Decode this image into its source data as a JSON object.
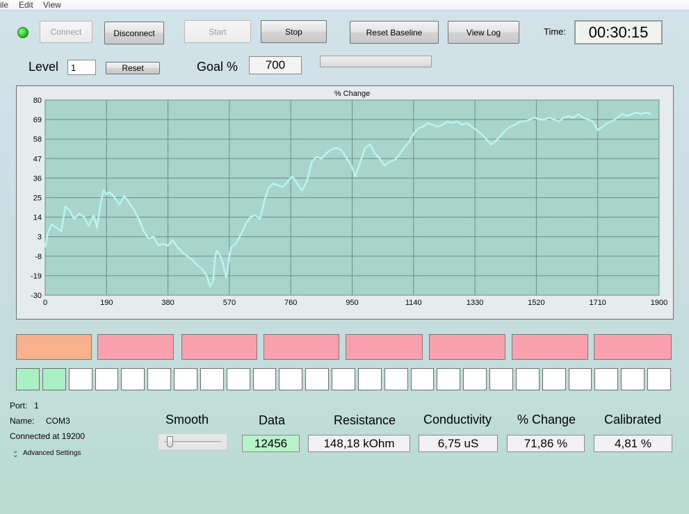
{
  "menu": {
    "file": "ile",
    "edit": "Edit",
    "view": "View"
  },
  "colors": {
    "led": "#22c422",
    "plot_bg": "#a9d4c9",
    "plot_line": "#b8f5ee",
    "grid": "#6a8e86"
  },
  "toolbar": {
    "connect": "Connect",
    "disconnect": "Disconnect",
    "start": "Start",
    "stop": "Stop",
    "reset_baseline": "Reset Baseline",
    "view_log": "View Log",
    "time_label": "Time:",
    "time_value": "00:30:15"
  },
  "level": {
    "label": "Level",
    "value": "1",
    "reset": "Reset"
  },
  "goal": {
    "label": "Goal %",
    "value": "700",
    "progress": 0
  },
  "chart_data": {
    "type": "line",
    "title": "% Change",
    "xlim": [
      0,
      1900
    ],
    "ylim": [
      -30,
      80
    ],
    "xticks": [
      0,
      190,
      380,
      570,
      760,
      950,
      1140,
      1330,
      1520,
      1710,
      1900
    ],
    "yticks": [
      80,
      69,
      58,
      47,
      36,
      25,
      14,
      3,
      -8,
      -19,
      -30
    ],
    "grid": true,
    "x": [
      0,
      8,
      20,
      35,
      50,
      62,
      75,
      90,
      105,
      120,
      135,
      150,
      160,
      170,
      180,
      190,
      200,
      215,
      230,
      245,
      260,
      275,
      290,
      305,
      320,
      335,
      350,
      365,
      380,
      395,
      410,
      425,
      440,
      455,
      470,
      485,
      500,
      510,
      520,
      525,
      530,
      540,
      550,
      560,
      565,
      570,
      575,
      590,
      605,
      620,
      635,
      650,
      665,
      680,
      690,
      705,
      720,
      735,
      750,
      765,
      780,
      795,
      810,
      825,
      840,
      855,
      870,
      885,
      900,
      915,
      930,
      945,
      960,
      975,
      990,
      1005,
      1020,
      1035,
      1050,
      1065,
      1080,
      1095,
      1110,
      1125,
      1140,
      1155,
      1170,
      1185,
      1200,
      1215,
      1230,
      1245,
      1260,
      1275,
      1290,
      1305,
      1320,
      1335,
      1350,
      1365,
      1380,
      1395,
      1410,
      1425,
      1440,
      1455,
      1470,
      1485,
      1500,
      1515,
      1530,
      1545,
      1560,
      1575,
      1590,
      1605,
      1620,
      1635,
      1650,
      1665,
      1680,
      1695,
      1710,
      1725,
      1740,
      1755,
      1770,
      1785,
      1800,
      1815,
      1830,
      1845,
      1860,
      1875
    ],
    "y": [
      -3,
      5,
      10,
      8,
      6,
      20,
      18,
      13,
      16,
      14,
      9,
      15,
      8,
      20,
      29,
      27,
      28,
      25,
      21,
      26,
      22,
      18,
      13,
      6,
      2,
      3,
      -2,
      -1,
      -2,
      1,
      -3,
      -6,
      -8,
      -10,
      -13,
      -15,
      -19,
      -25,
      -22,
      -10,
      -5,
      -7,
      -12,
      -20,
      -15,
      -8,
      -3,
      -1,
      4,
      10,
      14,
      15,
      13,
      24,
      30,
      33,
      32,
      31,
      34,
      37,
      33,
      29,
      34,
      45,
      48,
      47,
      50,
      52,
      53,
      52,
      48,
      44,
      37,
      45,
      53,
      55,
      50,
      47,
      43,
      45,
      46,
      49,
      53,
      56,
      61,
      64,
      65,
      67,
      66,
      65,
      66,
      68,
      67,
      68,
      66,
      67,
      65,
      63,
      61,
      58,
      55,
      57,
      60,
      63,
      65,
      66,
      68,
      68,
      69,
      70,
      69,
      69,
      70,
      69,
      68,
      70,
      71,
      70,
      72,
      70,
      69,
      68,
      63,
      65,
      67,
      68,
      70,
      72,
      71,
      72,
      73,
      72,
      73,
      72
    ]
  },
  "status_bars": [
    {
      "color": "#f8b18f"
    },
    {
      "color": "#f8a0ae"
    },
    {
      "color": "#f8a0ae"
    },
    {
      "color": "#f8a0ae"
    },
    {
      "color": "#f8a0ae"
    },
    {
      "color": "#f8a0ae"
    },
    {
      "color": "#f8a0ae"
    },
    {
      "color": "#f8a0ae"
    }
  ],
  "cells": {
    "filled": 2,
    "total": 25,
    "fill_color": "#a9f0c4"
  },
  "port": {
    "port_label": "Port:",
    "port_value": "1",
    "name_label": "Name:",
    "name_value": "COM3",
    "connected": "Connected at 19200",
    "advanced": "Advanced Settings"
  },
  "readouts": {
    "smooth_label": "Smooth",
    "smooth_level": 0.05,
    "data_label": "Data",
    "data_value": "12456",
    "resistance_label": "Resistance",
    "resistance_value": "148,18 kOhm",
    "conductivity_label": "Conductivity",
    "conductivity_value": "6,75 uS",
    "change_label": "% Change",
    "change_value": "71,86 %",
    "calibrated_label": "Calibrated",
    "calibrated_value": "4,81 %"
  }
}
